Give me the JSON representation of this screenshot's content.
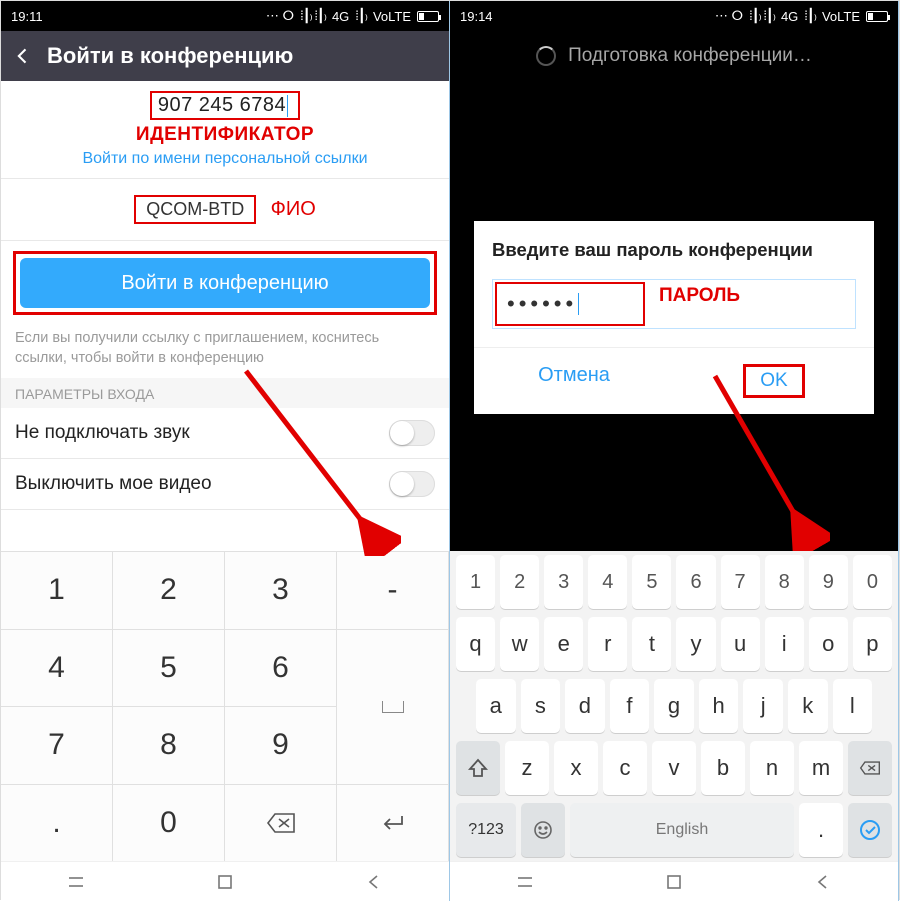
{
  "left": {
    "status": {
      "time": "19:11",
      "net": "4G",
      "volte": "VoLTE"
    },
    "header": {
      "title": "Войти в конференцию"
    },
    "meeting_id": "907 245 6784",
    "annot_id": "ИДЕНТИФИКАТОР",
    "personal_link": "Войти по имени персональной ссылки",
    "display_name": "QCOM-BTD",
    "annot_name": "ФИО",
    "join_btn": "Войти в конференцию",
    "hint": "Если вы получили ссылку с приглашением, коснитесь ссылки, чтобы войти в конференцию",
    "section": "ПАРАМЕТРЫ ВХОДА",
    "opt_audio": "Не подключать звук",
    "opt_video": "Выключить мое видео",
    "keypad": [
      "1",
      "2",
      "3",
      "-",
      "4",
      "5",
      "6",
      " ",
      "7",
      "8",
      "9",
      "⌫",
      ".",
      "0",
      "",
      "↵"
    ]
  },
  "right": {
    "status": {
      "time": "19:14",
      "net": "4G",
      "volte": "VoLTE"
    },
    "prep": "Подготовка конференции…",
    "dlg_title": "Введите ваш пароль конференции",
    "password_mask": "••••••",
    "annot_pw": "ПАРОЛЬ",
    "cancel": "Отмена",
    "ok": "OK",
    "kb": {
      "r1": [
        "1",
        "2",
        "3",
        "4",
        "5",
        "6",
        "7",
        "8",
        "9",
        "0"
      ],
      "r2": [
        "q",
        "w",
        "e",
        "r",
        "t",
        "y",
        "u",
        "i",
        "o",
        "p"
      ],
      "r3": [
        "a",
        "s",
        "d",
        "f",
        "g",
        "h",
        "j",
        "k",
        "l"
      ],
      "r4": [
        "z",
        "x",
        "c",
        "v",
        "b",
        "n",
        "m"
      ],
      "sym": "?123",
      "space": "English"
    }
  }
}
